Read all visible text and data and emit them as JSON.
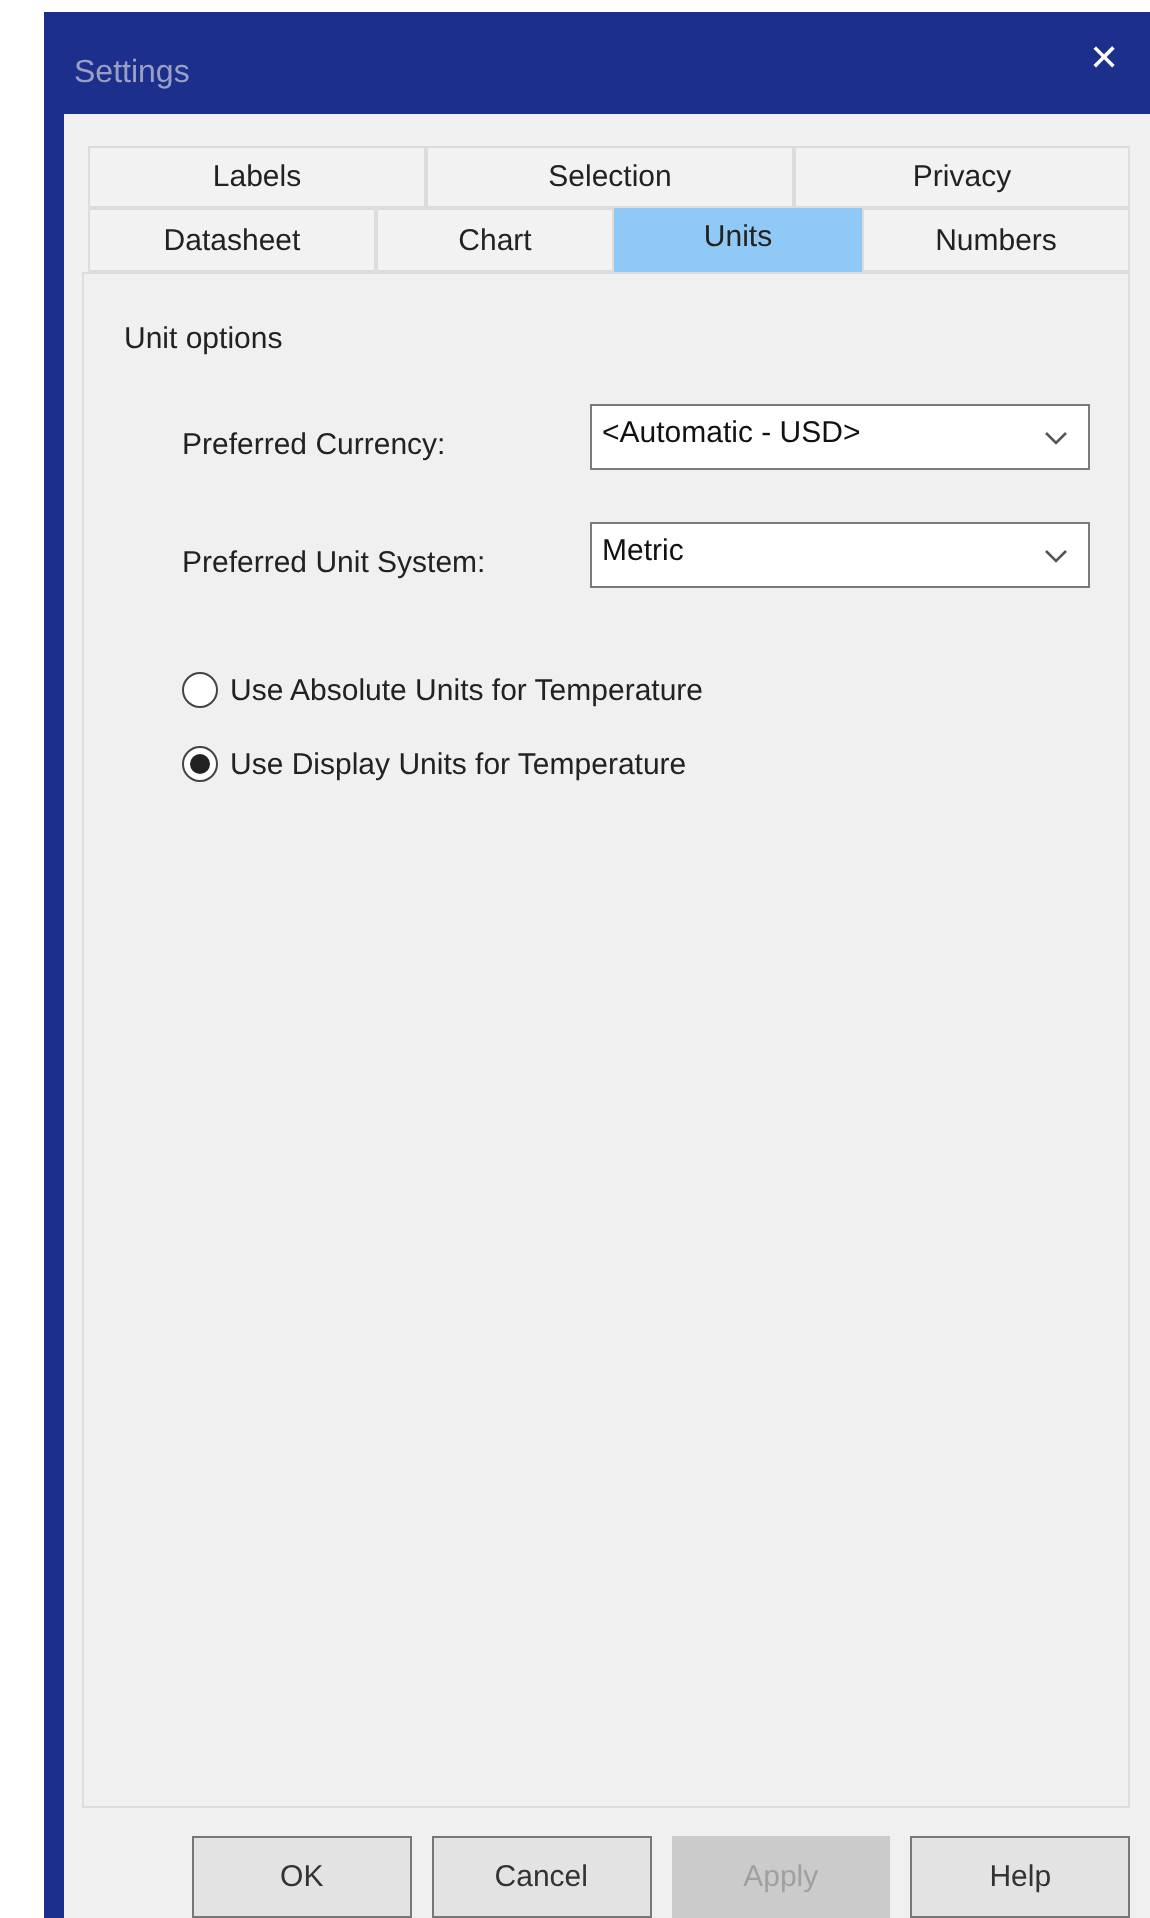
{
  "window": {
    "title": "Settings",
    "close": "✕"
  },
  "tab_rows": [
    [
      {
        "label": "Labels",
        "selected": false
      },
      {
        "label": "Selection",
        "selected": false
      },
      {
        "label": "Privacy",
        "selected": false
      }
    ],
    [
      {
        "label": "Datasheet",
        "selected": false
      },
      {
        "label": "Chart",
        "selected": false
      },
      {
        "label": "Units",
        "selected": true
      },
      {
        "label": "Numbers",
        "selected": false
      }
    ]
  ],
  "group": {
    "title": "Unit options"
  },
  "fields": [
    {
      "label": "Preferred Currency:",
      "value": "<Automatic - USD>"
    },
    {
      "label": "Preferred Unit System:",
      "value": "Metric"
    }
  ],
  "radios": [
    {
      "label": "Use Absolute Units for Temperature",
      "selected": false
    },
    {
      "label": "Use Display Units for Temperature",
      "selected": true
    }
  ],
  "buttons": [
    {
      "label": "OK",
      "disabled": false
    },
    {
      "label": "Cancel",
      "disabled": false
    },
    {
      "label": "Apply",
      "disabled": true
    },
    {
      "label": "Help",
      "disabled": false
    }
  ]
}
